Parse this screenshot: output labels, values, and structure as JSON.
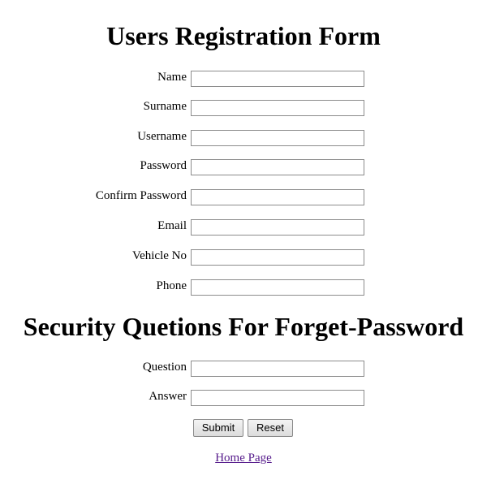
{
  "title": "Users Registration Form",
  "fields": [
    {
      "label": "Name",
      "value": ""
    },
    {
      "label": "Surname",
      "value": ""
    },
    {
      "label": "Username",
      "value": ""
    },
    {
      "label": "Password",
      "value": ""
    },
    {
      "label": "Confirm Password",
      "value": ""
    },
    {
      "label": "Email",
      "value": ""
    },
    {
      "label": "Vehicle No",
      "value": ""
    },
    {
      "label": "Phone",
      "value": ""
    }
  ],
  "security": {
    "title": "Security Quetions For Forget-Password",
    "fields": [
      {
        "label": "Question",
        "value": ""
      },
      {
        "label": "Answer",
        "value": ""
      }
    ]
  },
  "buttons": {
    "submit_label": "Submit",
    "reset_label": "Reset"
  },
  "home_link": "Home Page",
  "colors": {
    "link_visited": "#551a8b",
    "input_border": "#8c8c8c"
  }
}
